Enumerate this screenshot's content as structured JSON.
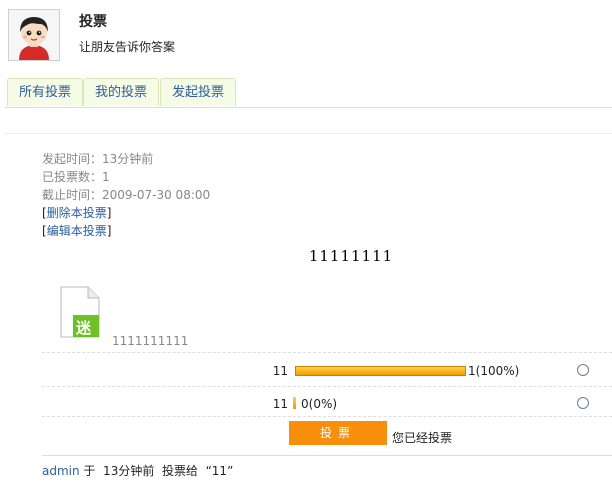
{
  "header": {
    "title": "投票",
    "subtitle": "让朋友告诉你答案"
  },
  "tabs": [
    {
      "label": "所有投票"
    },
    {
      "label": "我的投票"
    },
    {
      "label": "发起投票"
    }
  ],
  "meta": {
    "started": "发起时间：13分钟前",
    "vote_count": "已投票数：1",
    "deadline": "截止时间：2009-07-30 08:00",
    "delete_link": "删除本投票",
    "edit_link": "编辑本投票",
    "bracket_open": "[",
    "bracket_close": "]"
  },
  "poll": {
    "title": "11111111",
    "file_icon_char": "迷",
    "option_label": "1111111111",
    "options": [
      {
        "name": "11",
        "result": "1(100%)",
        "share": 1.0
      },
      {
        "name": "11",
        "result": "0(0%)",
        "share": 0.0
      }
    ],
    "vote_button": "投票",
    "voted_text": "您已经投票"
  },
  "activity": {
    "user": "admin",
    "text": " 于  13分钟前  投票给  “11”"
  },
  "colors": {
    "link": "#2a5f9e",
    "bar": "#f09a00",
    "button": "#f78f0c",
    "tab_bg": "#f6fbe6"
  }
}
